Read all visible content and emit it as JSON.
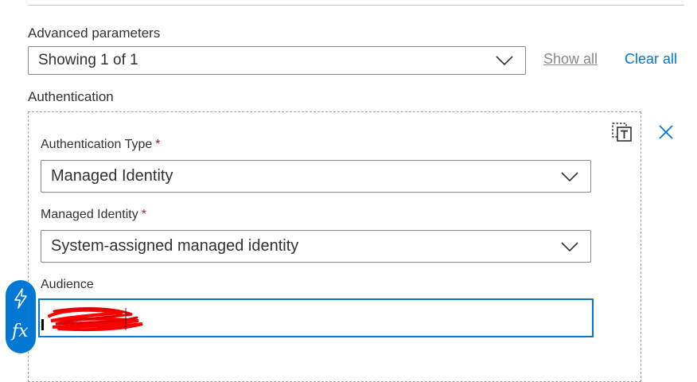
{
  "advanced": {
    "label": "Advanced parameters",
    "selected": "Showing 1 of 1",
    "show_all": "Show all",
    "clear_all": "Clear all"
  },
  "authentication": {
    "label": "Authentication",
    "type_label": "Authentication Type",
    "type_value": "Managed Identity",
    "identity_label": "Managed Identity",
    "identity_value": "System-assigned managed identity",
    "audience_label": "Audience",
    "required_marker": "*"
  },
  "token_picker": {
    "fx": "fx"
  },
  "icons": {
    "chevron": "chevron-down-icon",
    "remove_parameter": "remove-parameter-icon",
    "close": "close-icon",
    "dynamic_content": "lightning-icon",
    "expression": "fx-icon"
  },
  "colors": {
    "accent": "#0078d4",
    "required": "#a4262c",
    "redaction": "#ff0000"
  }
}
